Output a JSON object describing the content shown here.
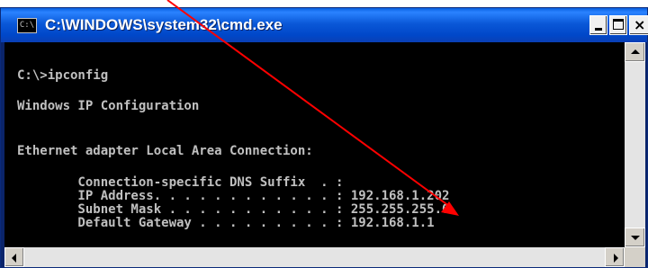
{
  "window": {
    "title": "C:\\WINDOWS\\system32\\cmd.exe",
    "icon_label": "C:\\",
    "icon": "cmd-icon",
    "title_bar_color": "#0a58d8"
  },
  "titlebar_buttons": {
    "minimize": "minimize-icon",
    "maximize": "maximize-icon",
    "close_glyph": "×"
  },
  "console": {
    "background": "#000000",
    "text_color": "#c0c0c0",
    "lines": [
      "C:\\>ipconfig",
      "Windows IP Configuration",
      "Ethernet adapter Local Area Connection:",
      "        Connection-specific DNS Suffix  . :",
      "        IP Address. . . . . . . . . . . . : 192.168.1.202",
      "        Subnet Mask . . . . . . . . . . . : 255.255.255.0",
      "        Default Gateway . . . . . . . . . : 192.168.1.1"
    ]
  },
  "annotation": {
    "arrow_color": "#ff0000"
  }
}
